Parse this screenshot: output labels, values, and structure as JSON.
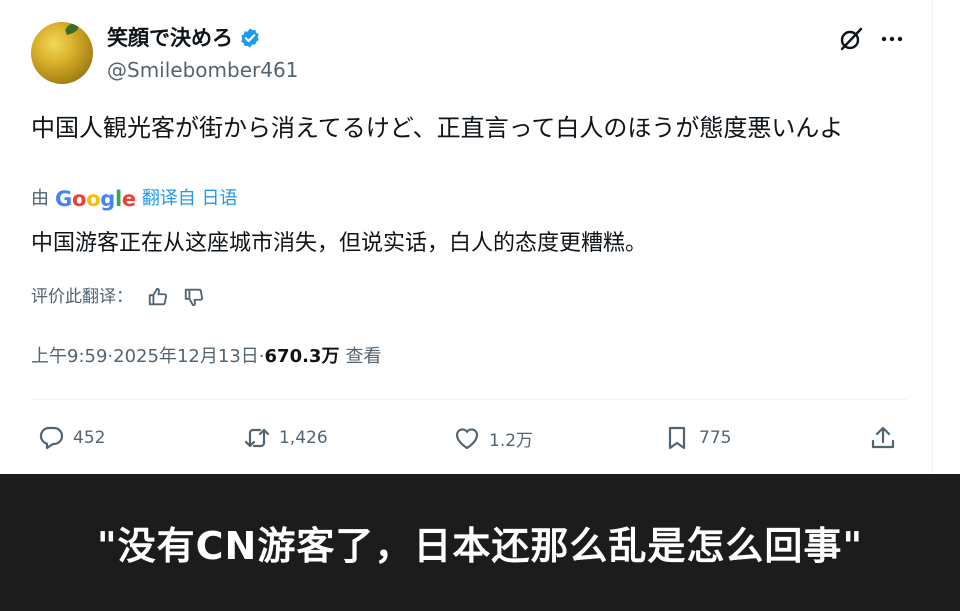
{
  "author": {
    "display_name": "笑顔で決めろ",
    "handle": "@Smilebomber461",
    "verified": true
  },
  "tweet": {
    "text": "中国人観光客が街から消えてるけど、正直言って白人のほうが態度悪いんよ",
    "translation": {
      "by_label": "由",
      "provider": "Google",
      "translated_from": "翻译自 日语",
      "text": "中国游客正在从这座城市消失，但说实话，白人的态度更糟糕。",
      "rate_label": "评价此翻译："
    },
    "time": "上午9:59",
    "date": "2025年12月13日",
    "views": "670.3万",
    "views_label": "查看",
    "separator": " · "
  },
  "actions": {
    "replies": "452",
    "reposts": "1,426",
    "likes": "1.2万",
    "bookmarks": "775"
  },
  "caption": {
    "text": "\"没有CN游客了，日本还那么乱是怎么回事\""
  },
  "colors": {
    "verified_blue": "#1d9bf0",
    "link_blue": "#1d9bf0",
    "secondary_text": "#536471",
    "caption_background": "#1c1c1c"
  },
  "icons": [
    "verified-badge-icon",
    "grok-icon",
    "more-icon",
    "thumbs-up-icon",
    "thumbs-down-icon",
    "reply-icon",
    "repost-icon",
    "like-icon",
    "bookmark-icon",
    "share-icon"
  ]
}
